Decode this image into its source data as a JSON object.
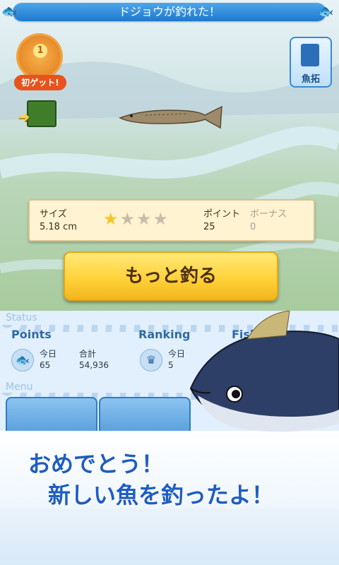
{
  "header": {
    "title": "ドジョウが釣れた！"
  },
  "badge": {
    "number": "1",
    "label": "初ゲット!"
  },
  "gyotaku_button": {
    "label": "魚拓"
  },
  "catch_info": {
    "size_label": "サイズ",
    "size_value": "5.18 cm",
    "rating_stars": 1,
    "rating_max": 4,
    "points_label": "ポイント",
    "points_value": "25",
    "bonus_label": "ボーナス",
    "bonus_value": "0"
  },
  "more_button": {
    "label": "もっと釣る"
  },
  "status": {
    "section_title": "Status",
    "points_title": "Points",
    "today_label": "今日",
    "today_points": "65",
    "total_label": "合計",
    "total_points": "54,936",
    "ranking_title": "Ranking",
    "ranking_today_label": "今日",
    "ranking_today_value": "5",
    "fish_title": "Fish"
  },
  "menu": {
    "section_title": "Menu"
  },
  "banner": {
    "line1": "おめでとう！",
    "line2": "新しい魚を釣ったよ！"
  },
  "colors": {
    "title_bar": "#1d78cf",
    "button_gold": "#ffd23a",
    "banner_text": "#1d5ec2"
  }
}
